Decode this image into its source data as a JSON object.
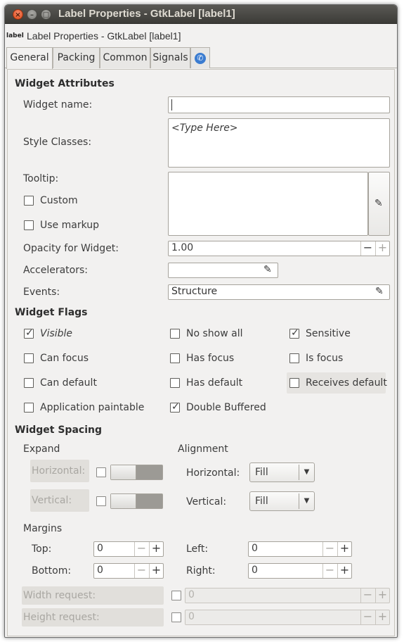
{
  "window": {
    "title": "Label Properties - GtkLabel [label1]"
  },
  "header": {
    "icon_text": "label",
    "title": "Label Properties - GtkLabel [label1]"
  },
  "tabs": [
    {
      "label": "General"
    },
    {
      "label": "Packing"
    },
    {
      "label": "Common"
    },
    {
      "label": "Signals"
    }
  ],
  "attrs": {
    "heading": "Widget Attributes",
    "widget_name_label": "Widget name:",
    "widget_name_value": "",
    "style_classes_label": "Style Classes:",
    "style_classes_placeholder": "<Type Here>",
    "tooltip_label": "Tooltip:",
    "custom_label": "Custom",
    "markup_label": "Use markup",
    "opacity_label": "Opacity for Widget:",
    "opacity_value": "1.00",
    "accelerators_label": "Accelerators:",
    "events_label": "Events:",
    "events_value": "Structure"
  },
  "flags": {
    "heading": "Widget Flags",
    "items": [
      {
        "label": "Visible",
        "checked": true
      },
      {
        "label": "No show all",
        "checked": false
      },
      {
        "label": "Sensitive",
        "checked": true
      },
      {
        "label": "Can focus",
        "checked": false
      },
      {
        "label": "Has focus",
        "checked": false
      },
      {
        "label": "Is focus",
        "checked": false
      },
      {
        "label": "Can default",
        "checked": false
      },
      {
        "label": "Has default",
        "checked": false
      },
      {
        "label": "Receives default",
        "checked": false
      },
      {
        "label": "Application paintable",
        "checked": false
      },
      {
        "label": "Double Buffered",
        "checked": true
      }
    ]
  },
  "spacing": {
    "heading": "Widget Spacing",
    "expand_label": "Expand",
    "alignment_label": "Alignment",
    "expand_horizontal": "Horizontal:",
    "expand_vertical": "Vertical:",
    "align_horizontal_label": "Horizontal:",
    "align_horizontal_value": "Fill",
    "align_vertical_label": "Vertical:",
    "align_vertical_value": "Fill",
    "margins_label": "Margins",
    "top_label": "Top:",
    "top_value": "0",
    "bottom_label": "Bottom:",
    "bottom_value": "0",
    "left_label": "Left:",
    "left_value": "0",
    "right_label": "Right:",
    "right_value": "0",
    "width_request_label": "Width request:",
    "width_request_value": "0",
    "height_request_label": "Height request:",
    "height_request_value": "0"
  },
  "icons": {
    "minus": "−",
    "plus": "+",
    "edit": "✎",
    "dropdown": "▼",
    "accessibility": "accessibility-icon"
  }
}
